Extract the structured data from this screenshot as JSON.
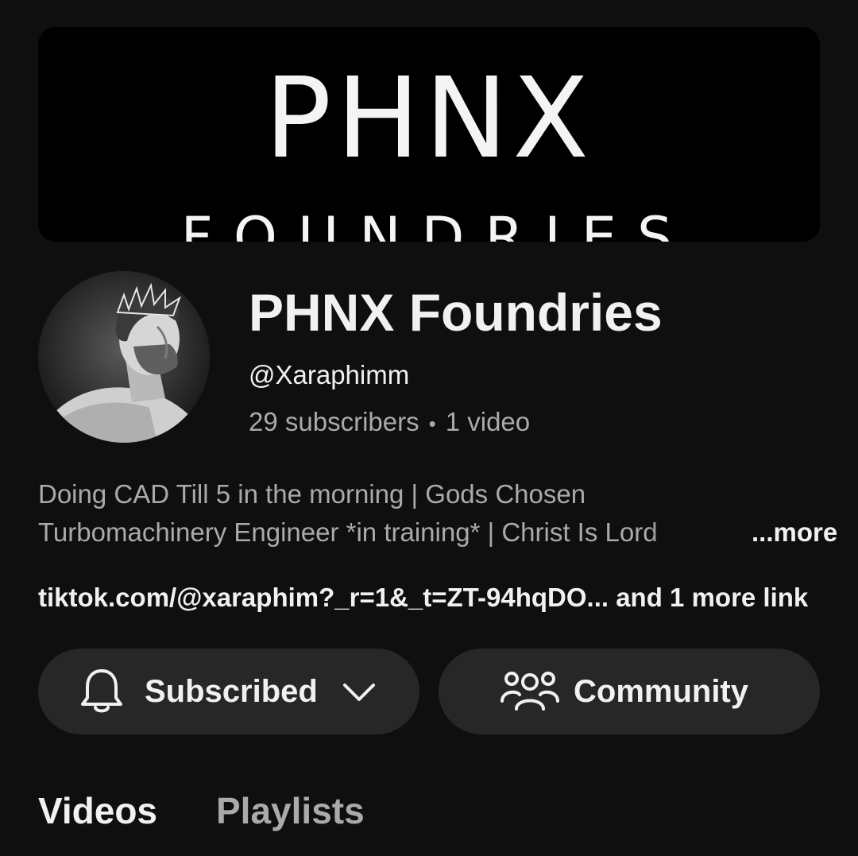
{
  "banner": {
    "line1": "PHNX",
    "line2": "FOUNDRIES"
  },
  "channel": {
    "name": "PHNX Foundries",
    "handle": "@Xaraphimm",
    "subscribers": "29 subscribers",
    "separator": "•",
    "videos": "1 video"
  },
  "description": {
    "line1": "Doing CAD Till 5 in the morning | Gods Chosen",
    "line2": "Turbomachinery Engineer *in training* | Christ Is Lord",
    "more_label": "...more"
  },
  "links": {
    "text": "tiktok.com/@xaraphim?_r=1&_t=ZT-94hqDO... and 1 more link"
  },
  "buttons": {
    "subscribed_label": "Subscribed",
    "community_label": "Community"
  },
  "tabs": [
    {
      "label": "Videos",
      "active": true
    },
    {
      "label": "Playlists",
      "active": false
    }
  ],
  "icons": {
    "subscribed": "bell-icon",
    "dropdown": "chevron-down-icon",
    "community": "people-icon"
  },
  "colors": {
    "background": "#0f0f0f",
    "button_bg": "#272727",
    "text_primary": "#f1f1f1",
    "text_secondary": "#aaaaaa"
  }
}
